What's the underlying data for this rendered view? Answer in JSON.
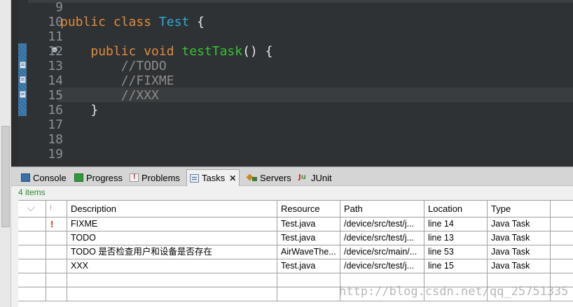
{
  "editor": {
    "lines": [
      {
        "num": "9",
        "tokens": []
      },
      {
        "num": "10",
        "tokens": [
          {
            "cls": "kw",
            "text": "public class "
          },
          {
            "cls": "cls",
            "text": "Test"
          },
          {
            "cls": "pun",
            "text": " {"
          }
        ]
      },
      {
        "num": "11",
        "tokens": []
      },
      {
        "num": "12",
        "tokens": [
          {
            "cls": "pun",
            "text": "    "
          },
          {
            "cls": "kw",
            "text": "public void "
          },
          {
            "cls": "mth",
            "text": "testTask"
          },
          {
            "cls": "pun",
            "text": "() {"
          }
        ]
      },
      {
        "num": "13",
        "tokens": [
          {
            "cls": "cmt",
            "text": "        //TODO"
          }
        ]
      },
      {
        "num": "14",
        "tokens": [
          {
            "cls": "cmt",
            "text": "        //FIXME"
          }
        ]
      },
      {
        "num": "15",
        "tokens": [
          {
            "cls": "cmt",
            "text": "        //XXX"
          }
        ]
      },
      {
        "num": "16",
        "tokens": [
          {
            "cls": "pun",
            "text": "    }"
          }
        ]
      },
      {
        "num": "17",
        "tokens": []
      },
      {
        "num": "18",
        "tokens": []
      },
      {
        "num": "19",
        "tokens": []
      }
    ]
  },
  "tabs": [
    {
      "name": "console",
      "label": "Console",
      "icon": "console-icon"
    },
    {
      "name": "progress",
      "label": "Progress",
      "icon": "progress-icon"
    },
    {
      "name": "problems",
      "label": "Problems",
      "icon": "problems-icon"
    },
    {
      "name": "tasks",
      "label": "Tasks",
      "icon": "tasks-icon",
      "active": true
    },
    {
      "name": "servers",
      "label": "Servers",
      "icon": "servers-icon"
    },
    {
      "name": "junit",
      "label": "JUnit",
      "icon": "junit-icon"
    }
  ],
  "tasks_view": {
    "items_count": "4 items",
    "columns": [
      "",
      "!",
      "Description",
      "Resource",
      "Path",
      "Location",
      "Type"
    ],
    "rows": [
      {
        "priority": "!",
        "description": "FIXME",
        "resource": "Test.java",
        "path": "/device/src/test/j...",
        "location": "line 14",
        "type": "Java Task"
      },
      {
        "priority": "",
        "description": "TODO",
        "resource": "Test.java",
        "path": "/device/src/test/j...",
        "location": "line 13",
        "type": "Java Task"
      },
      {
        "priority": "",
        "description": "TODO 是否检查用户和设备是否存在",
        "resource": "AirWaveThe...",
        "path": "/device/src/main/...",
        "location": "line 53",
        "type": "Java Task"
      },
      {
        "priority": "",
        "description": "XXX",
        "resource": "Test.java",
        "path": "/device/src/test/j...",
        "location": "line 15",
        "type": "Java Task"
      }
    ]
  },
  "watermark": "http://blog.csdn.net/qq_25751335",
  "colors": {
    "keyword": "#e08b3a",
    "class": "#2aa9d6",
    "method": "#34c234",
    "comment": "#8c8c8c",
    "editor_bg": "#2f3234",
    "items_count": "#2b8a2b",
    "priority_high": "#d21a1a"
  }
}
